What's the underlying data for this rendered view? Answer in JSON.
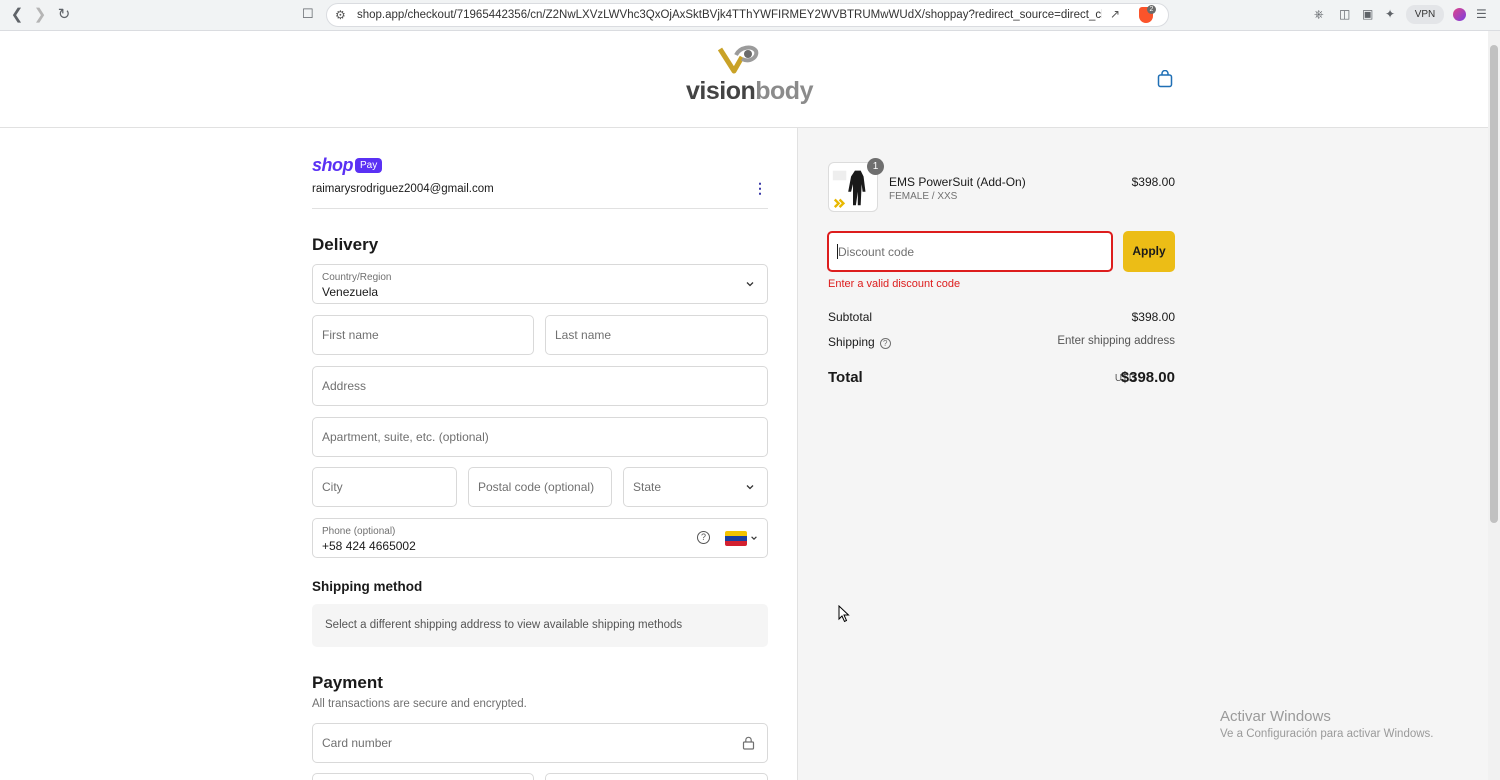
{
  "browser": {
    "url": "shop.app/checkout/71965442356/cn/Z2NwLXVzLWVhc3QxOjAxSktBVjk4TThYWFIRMEY2WVBTRUMwWUdX/shoppay?redirect_source=direct_checkout_p...",
    "shield_count": "2",
    "vpn_label": "VPN"
  },
  "header": {
    "logo_vision": "vision",
    "logo_body": "body"
  },
  "account": {
    "shop_label": "shop",
    "pay_label": "Pay",
    "email": "raimarysrodriguez2004@gmail.com"
  },
  "delivery": {
    "heading": "Delivery",
    "country_label": "Country/Region",
    "country_value": "Venezuela",
    "first_name_placeholder": "First name",
    "last_name_placeholder": "Last name",
    "address_placeholder": "Address",
    "apartment_placeholder": "Apartment, suite, etc. (optional)",
    "city_placeholder": "City",
    "postal_placeholder": "Postal code (optional)",
    "state_placeholder": "State",
    "phone_label": "Phone (optional)",
    "phone_value": "+58 424 4665002"
  },
  "shipping_method": {
    "heading": "Shipping method",
    "message": "Select a different shipping address to view available shipping methods"
  },
  "payment": {
    "heading": "Payment",
    "secure_text": "All transactions are secure and encrypted.",
    "card_number_placeholder": "Card number"
  },
  "summary": {
    "item": {
      "quantity": "1",
      "name": "EMS PowerSuit (Add-On)",
      "variant": "FEMALE / XXS",
      "price": "$398.00"
    },
    "discount_placeholder": "Discount code",
    "apply_label": "Apply",
    "discount_error": "Enter a valid discount code",
    "subtotal_label": "Subtotal",
    "subtotal_value": "$398.00",
    "shipping_label": "Shipping",
    "shipping_value": "Enter shipping address",
    "total_label": "Total",
    "total_currency": "USD",
    "total_value": "$398.00"
  },
  "watermark": {
    "title": "Activar Windows",
    "subtitle": "Ve a Configuración para activar Windows."
  },
  "colors": {
    "accent": "#ecbd16",
    "error": "#dd1d1d",
    "shop_pay": "#5a31f4"
  }
}
